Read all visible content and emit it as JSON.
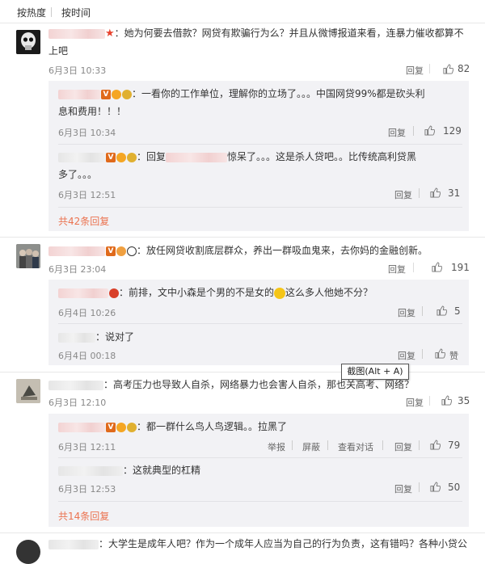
{
  "tabs": {
    "hot": "按热度",
    "time": "按时间"
  },
  "actions": {
    "reply": "回复",
    "report": "举报",
    "block": "屏蔽",
    "view_thread": "查看对话",
    "like_zan": "赞"
  },
  "tooltip": "截图(Alt + A)",
  "comments": [
    {
      "text_line1": "：她为何要去借款？网贷有欺骗行为么？并且从微博报道来看，连暴力催收都算不",
      "text_line2": "上吧",
      "time": "6月3日 10:33",
      "likes": "82",
      "replies": [
        {
          "text_line1": "：一看你的工作单位，理解你的立场了。。。中国网贷99%都是砍头利",
          "text_line2": "息和费用！！！",
          "time": "6月3日 10:34",
          "likes": "129"
        },
        {
          "prefix": "：回复",
          "text_line1": "惊呆了。。。这是杀人贷吧。。比传统高利贷黑",
          "text_line2": "多了。。。",
          "time": "6月3日 12:51",
          "likes": "31"
        }
      ],
      "more": "共42条回复"
    },
    {
      "text": "：放任网贷收割底层群众，养出一群吸血鬼来，去你妈的金融创新。",
      "time": "6月3日 23:04",
      "likes": "191",
      "replies": [
        {
          "text_a": "：前排，文中小森是个男的不是女的",
          "text_b": "这么多人他她不分？",
          "time": "6月4日 10:26",
          "likes": "5"
        },
        {
          "text": "：说对了",
          "time": "6月4日 00:18"
        }
      ]
    },
    {
      "text": "：高考压力也导致人自杀，网络暴力也会害人自杀，那也关高考、网络？",
      "time": "6月3日 12:10",
      "likes": "35",
      "replies": [
        {
          "text": "：都一群什么鸟人鸟逻辑。。拉黑了",
          "time": "6月3日 12:11",
          "likes": "79"
        },
        {
          "text": "：这就典型的杠精",
          "time": "6月3日 12:53",
          "likes": "50"
        }
      ],
      "more": "共14条回复"
    },
    {
      "text": "：大学生是成年人吧？作为一个成年人应当为自己的行为负责，这有错吗？各种小贷公"
    }
  ]
}
